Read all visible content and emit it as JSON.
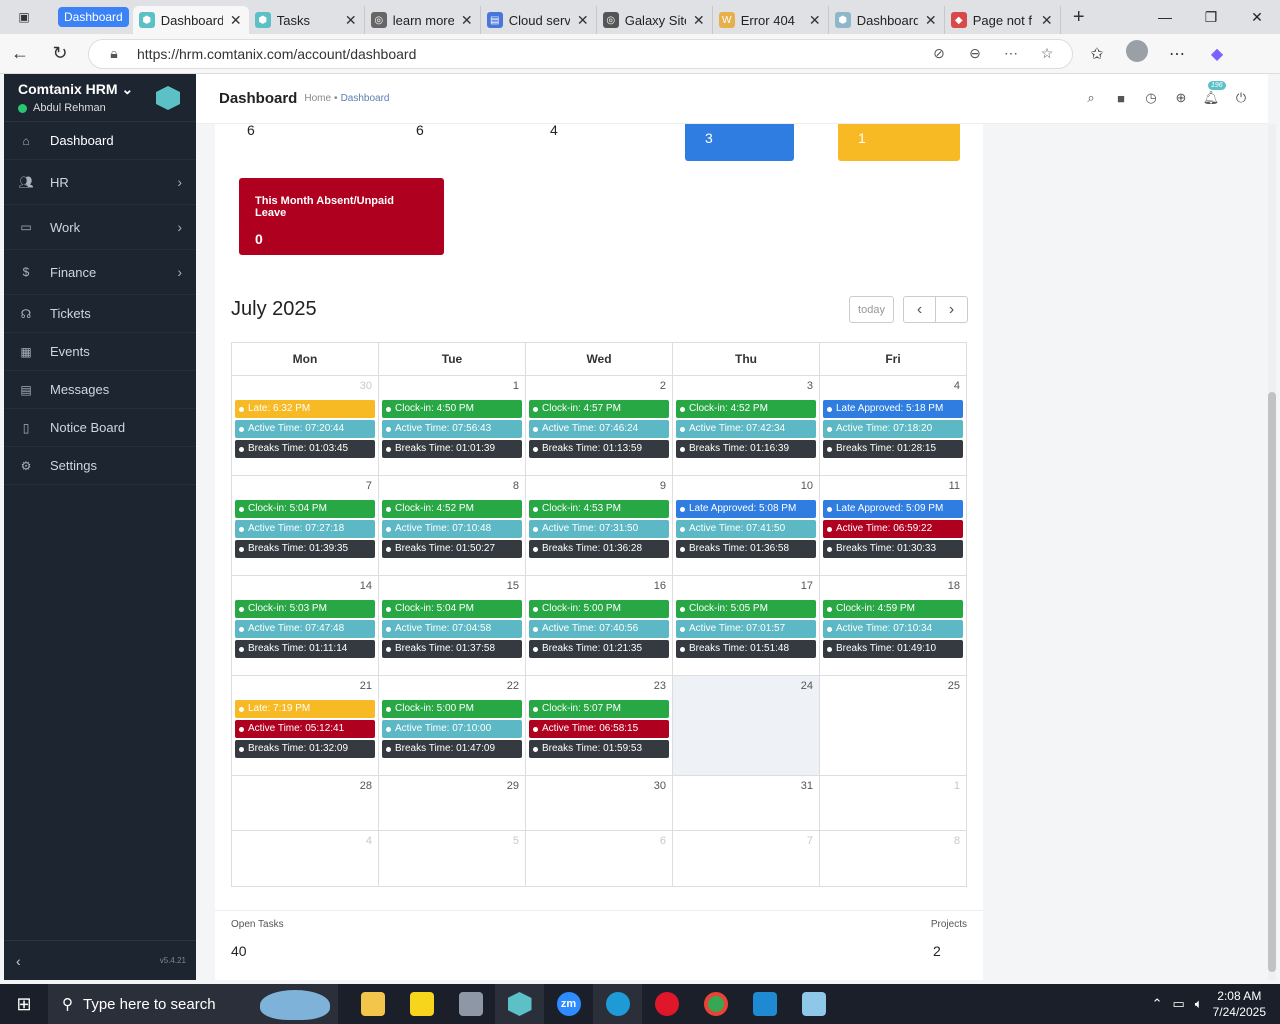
{
  "browser": {
    "group_chip": "Dashboard",
    "tabs": [
      {
        "label": "Dashboard",
        "icon": "hexagon-icon",
        "color": "#5cc0c7"
      },
      {
        "label": "Tasks",
        "icon": "hexagon-icon",
        "color": "#5cc0c7"
      },
      {
        "label": "learn more",
        "icon": "globe-icon",
        "color": "#666666"
      },
      {
        "label": "Cloud serv",
        "icon": "doc-icon",
        "color": "#4a76d9"
      },
      {
        "label": "Galaxy Site",
        "icon": "globe-icon",
        "color": "#555555"
      },
      {
        "label": "Error 404",
        "icon": "w-icon",
        "color": "#e8b04b"
      },
      {
        "label": "Dashboard",
        "icon": "hexagon-icon",
        "color": "#8fb6c9"
      },
      {
        "label": "Page not f",
        "icon": "diamond-icon",
        "color": "#d84a4a"
      }
    ],
    "url": "https://hrm.comtanix.com/account/dashboard"
  },
  "sidebar": {
    "app_name": "Comtanix HRM",
    "user_name": "Abdul Rehman",
    "items": [
      {
        "label": "Dashboard",
        "icon": "home-icon",
        "has_arrow": false
      },
      {
        "label": "HR",
        "icon": "users-icon",
        "has_arrow": true
      },
      {
        "label": "Work",
        "icon": "briefcase-icon",
        "has_arrow": true
      },
      {
        "label": "Finance",
        "icon": "dollar-icon",
        "has_arrow": true
      },
      {
        "label": "Tickets",
        "icon": "headset-icon",
        "has_arrow": false
      },
      {
        "label": "Events",
        "icon": "calendar-icon",
        "has_arrow": false
      },
      {
        "label": "Messages",
        "icon": "message-icon",
        "has_arrow": false
      },
      {
        "label": "Notice Board",
        "icon": "clipboard-icon",
        "has_arrow": false
      },
      {
        "label": "Settings",
        "icon": "gear-icon",
        "has_arrow": false
      }
    ],
    "version": "v5.4.21"
  },
  "header": {
    "title": "Dashboard",
    "breadcrumb_home": "Home",
    "breadcrumb_sep": "•",
    "breadcrumb_current": "Dashboard",
    "notification_count": "196"
  },
  "stats": {
    "partial_values": [
      "6",
      "6",
      "4"
    ],
    "blue_card_value": "3",
    "yellow_card_value": "1",
    "absent_title": "This Month Absent/Unpaid Leave",
    "absent_value": "0"
  },
  "calendar": {
    "title": "July 2025",
    "today_label": "today",
    "prev_label": "‹",
    "next_label": "›",
    "weekdays": [
      "Mon",
      "Tue",
      "Wed",
      "Thu",
      "Fri"
    ],
    "weeks": [
      {
        "days": [
          {
            "num": "30",
            "other": true,
            "events": [
              {
                "text": "Late: 6:32 PM",
                "kind": "late"
              },
              {
                "text": "Active Time: 07:20:44",
                "kind": "active"
              },
              {
                "text": "Breaks Time: 01:03:45",
                "kind": "break"
              }
            ]
          },
          {
            "num": "1",
            "events": [
              {
                "text": "Clock-in: 4:50 PM",
                "kind": "clock"
              },
              {
                "text": "Active Time: 07:56:43",
                "kind": "active"
              },
              {
                "text": "Breaks Time: 01:01:39",
                "kind": "break"
              }
            ]
          },
          {
            "num": "2",
            "events": [
              {
                "text": "Clock-in: 4:57 PM",
                "kind": "clock"
              },
              {
                "text": "Active Time: 07:46:24",
                "kind": "active"
              },
              {
                "text": "Breaks Time: 01:13:59",
                "kind": "break"
              }
            ]
          },
          {
            "num": "3",
            "events": [
              {
                "text": "Clock-in: 4:52 PM",
                "kind": "clock"
              },
              {
                "text": "Active Time: 07:42:34",
                "kind": "active"
              },
              {
                "text": "Breaks Time: 01:16:39",
                "kind": "break"
              }
            ]
          },
          {
            "num": "4",
            "events": [
              {
                "text": "Late Approved: 5:18 PM",
                "kind": "approved"
              },
              {
                "text": "Active Time: 07:18:20",
                "kind": "active"
              },
              {
                "text": "Breaks Time: 01:28:15",
                "kind": "break"
              }
            ]
          }
        ]
      },
      {
        "days": [
          {
            "num": "7",
            "events": [
              {
                "text": "Clock-in: 5:04 PM",
                "kind": "clock"
              },
              {
                "text": "Active Time: 07:27:18",
                "kind": "active"
              },
              {
                "text": "Breaks Time: 01:39:35",
                "kind": "break"
              }
            ]
          },
          {
            "num": "8",
            "events": [
              {
                "text": "Clock-in: 4:52 PM",
                "kind": "clock"
              },
              {
                "text": "Active Time: 07:10:48",
                "kind": "active"
              },
              {
                "text": "Breaks Time: 01:50:27",
                "kind": "break"
              }
            ]
          },
          {
            "num": "9",
            "events": [
              {
                "text": "Clock-in: 4:53 PM",
                "kind": "clock"
              },
              {
                "text": "Active Time: 07:31:50",
                "kind": "active"
              },
              {
                "text": "Breaks Time: 01:36:28",
                "kind": "break"
              }
            ]
          },
          {
            "num": "10",
            "events": [
              {
                "text": "Late Approved: 5:08 PM",
                "kind": "approved"
              },
              {
                "text": "Active Time: 07:41:50",
                "kind": "active"
              },
              {
                "text": "Breaks Time: 01:36:58",
                "kind": "break"
              }
            ]
          },
          {
            "num": "11",
            "events": [
              {
                "text": "Late Approved: 5:09 PM",
                "kind": "approved"
              },
              {
                "text": "Active Time: 06:59:22",
                "kind": "short"
              },
              {
                "text": "Breaks Time: 01:30:33",
                "kind": "break"
              }
            ]
          }
        ]
      },
      {
        "days": [
          {
            "num": "14",
            "events": [
              {
                "text": "Clock-in: 5:03 PM",
                "kind": "clock"
              },
              {
                "text": "Active Time: 07:47:48",
                "kind": "active"
              },
              {
                "text": "Breaks Time: 01:11:14",
                "kind": "break"
              }
            ]
          },
          {
            "num": "15",
            "events": [
              {
                "text": "Clock-in: 5:04 PM",
                "kind": "clock"
              },
              {
                "text": "Active Time: 07:04:58",
                "kind": "active"
              },
              {
                "text": "Breaks Time: 01:37:58",
                "kind": "break"
              }
            ]
          },
          {
            "num": "16",
            "events": [
              {
                "text": "Clock-in: 5:00 PM",
                "kind": "clock"
              },
              {
                "text": "Active Time: 07:40:56",
                "kind": "active"
              },
              {
                "text": "Breaks Time: 01:21:35",
                "kind": "break"
              }
            ]
          },
          {
            "num": "17",
            "events": [
              {
                "text": "Clock-in: 5:05 PM",
                "kind": "clock"
              },
              {
                "text": "Active Time: 07:01:57",
                "kind": "active"
              },
              {
                "text": "Breaks Time: 01:51:48",
                "kind": "break"
              }
            ]
          },
          {
            "num": "18",
            "events": [
              {
                "text": "Clock-in: 4:59 PM",
                "kind": "clock"
              },
              {
                "text": "Active Time: 07:10:34",
                "kind": "active"
              },
              {
                "text": "Breaks Time: 01:49:10",
                "kind": "break"
              }
            ]
          }
        ]
      },
      {
        "days": [
          {
            "num": "21",
            "events": [
              {
                "text": "Late: 7:19 PM",
                "kind": "late"
              },
              {
                "text": "Active Time: 05:12:41",
                "kind": "short"
              },
              {
                "text": "Breaks Time: 01:32:09",
                "kind": "break"
              }
            ]
          },
          {
            "num": "22",
            "events": [
              {
                "text": "Clock-in: 5:00 PM",
                "kind": "clock"
              },
              {
                "text": "Active Time: 07:10:00",
                "kind": "active"
              },
              {
                "text": "Breaks Time: 01:47:09",
                "kind": "break"
              }
            ]
          },
          {
            "num": "23",
            "events": [
              {
                "text": "Clock-in: 5:07 PM",
                "kind": "clock"
              },
              {
                "text": "Active Time: 06:58:15",
                "kind": "short"
              },
              {
                "text": "Breaks Time: 01:59:53",
                "kind": "break"
              }
            ]
          },
          {
            "num": "24",
            "today": true,
            "events": []
          },
          {
            "num": "25",
            "events": []
          }
        ]
      },
      {
        "days": [
          {
            "num": "28",
            "events": []
          },
          {
            "num": "29",
            "events": []
          },
          {
            "num": "30",
            "events": []
          },
          {
            "num": "31",
            "events": []
          },
          {
            "num": "1",
            "other": true,
            "events": []
          }
        ]
      },
      {
        "days": [
          {
            "num": "4",
            "other": true,
            "events": []
          },
          {
            "num": "5",
            "other": true,
            "events": []
          },
          {
            "num": "6",
            "other": true,
            "events": []
          },
          {
            "num": "7",
            "other": true,
            "events": []
          },
          {
            "num": "8",
            "other": true,
            "events": []
          }
        ]
      }
    ]
  },
  "event_colors": {
    "late": "#f7b924",
    "clock": "#28a745",
    "active": "#5cb8c4",
    "break": "#343a40",
    "approved": "#2f7de1",
    "short": "#b00020"
  },
  "footer": {
    "open_tasks_label": "Open Tasks",
    "open_tasks_value": "40",
    "projects_label": "Projects",
    "projects_value": "2"
  },
  "taskbar": {
    "search_placeholder": "Type here to search",
    "time": "2:08 AM",
    "date": "7/24/2025"
  }
}
